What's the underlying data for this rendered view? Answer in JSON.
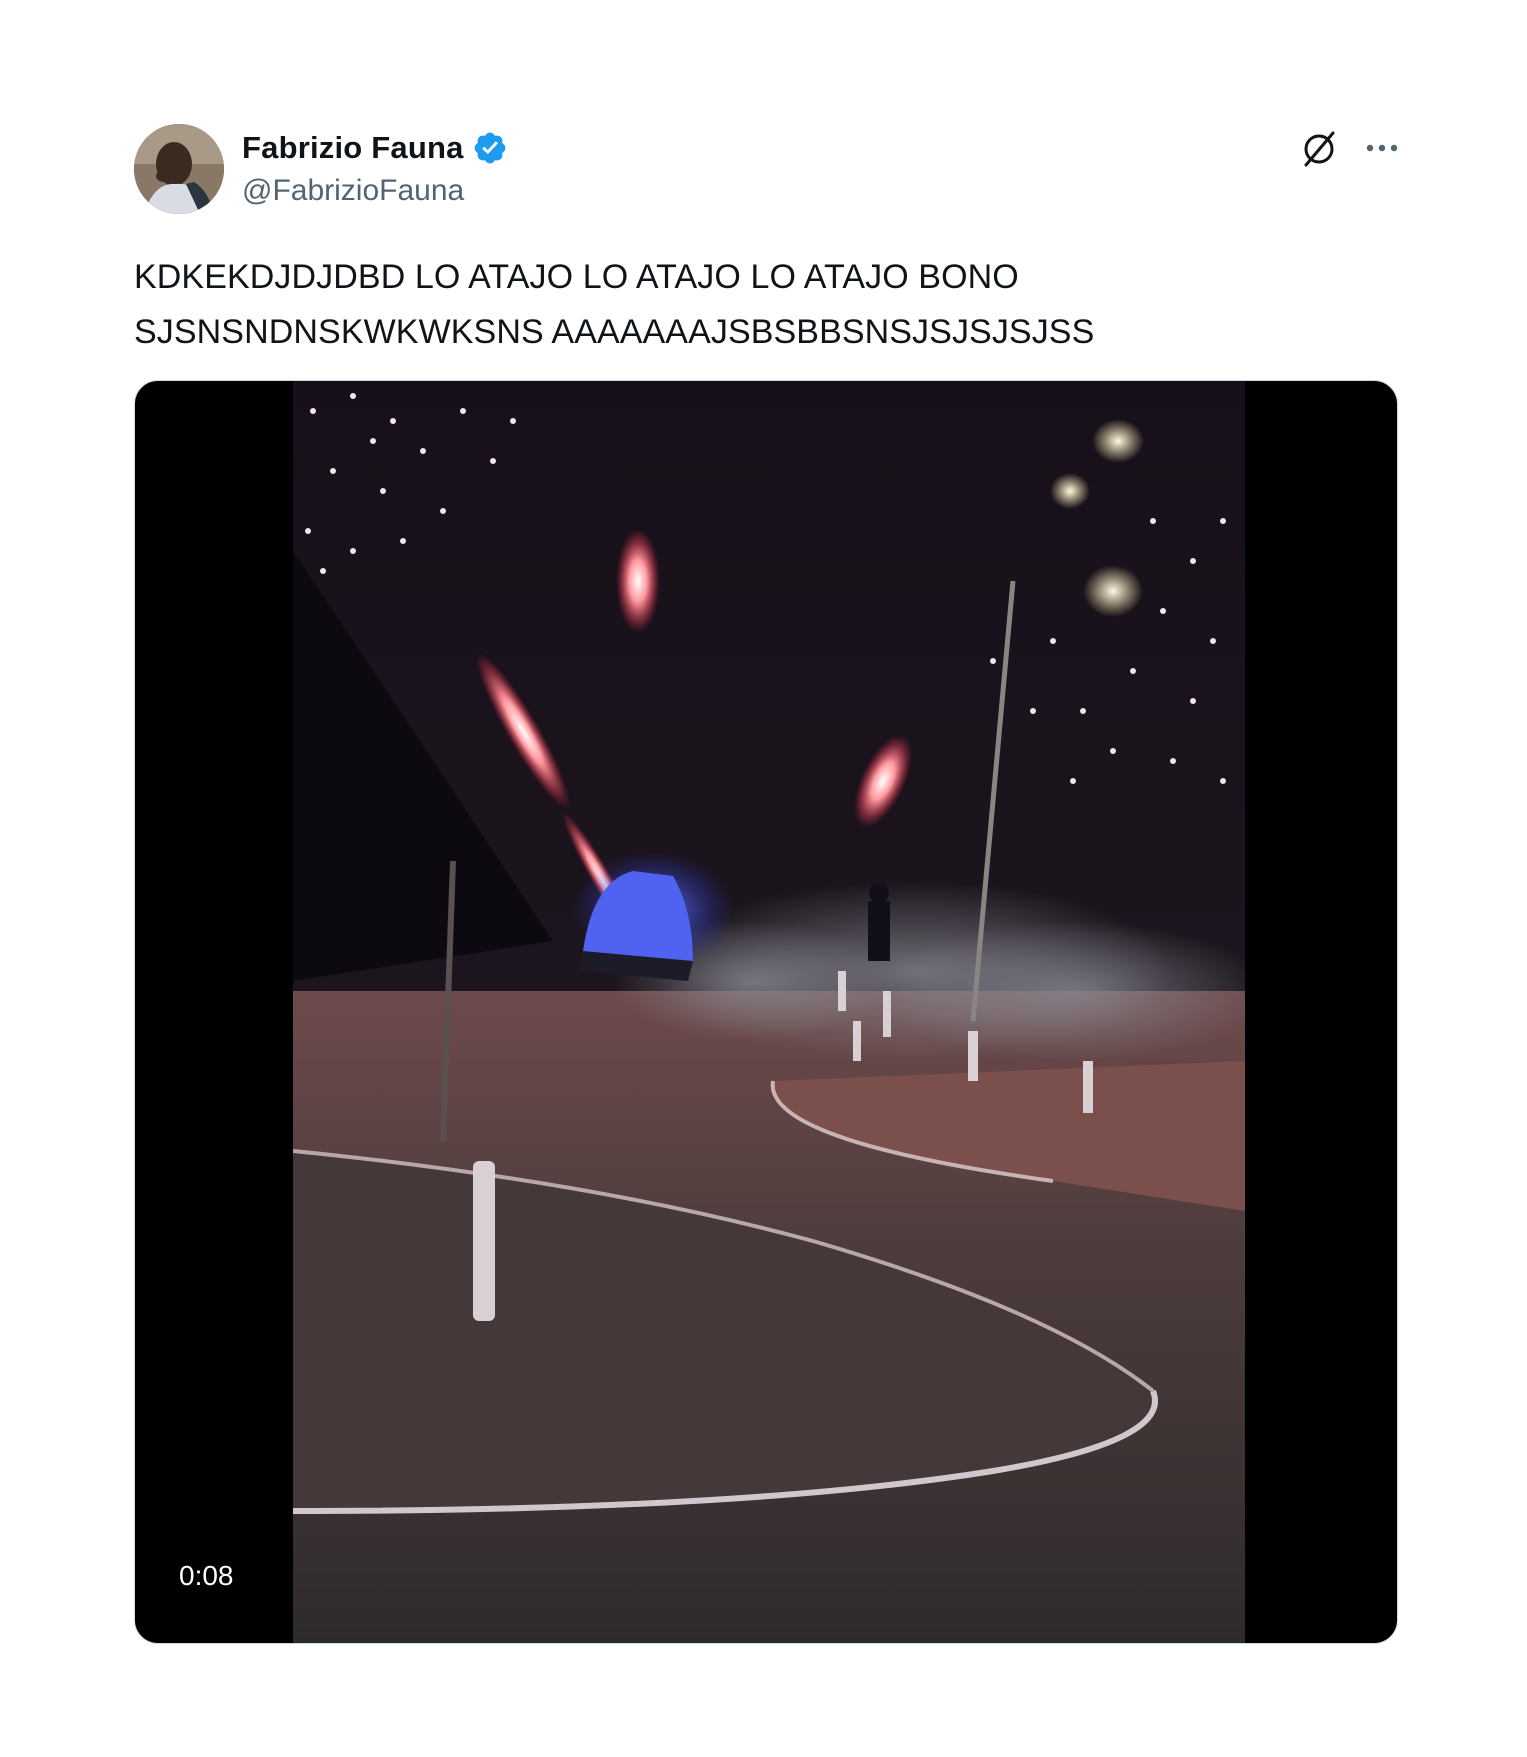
{
  "author": {
    "display_name": "Fabrizio Fauna",
    "handle": "@FabrizioFauna",
    "verified": true,
    "verified_color": "#1d9bf0"
  },
  "tweet": {
    "text": "KDKEKDJDJDBD LO ATAJO LO ATAJO LO ATAJO BONO\nSJSNSNDNSKWKWKSNS AAAAAAAJSBSBBSNSJSJSJSJSS"
  },
  "media": {
    "type": "video",
    "duration": "0:08"
  },
  "icons": {
    "grok": "grok-icon",
    "more": "more-icon"
  },
  "colors": {
    "text": "#0f1419",
    "secondary": "#536471",
    "media_border": "#cfd9de"
  }
}
